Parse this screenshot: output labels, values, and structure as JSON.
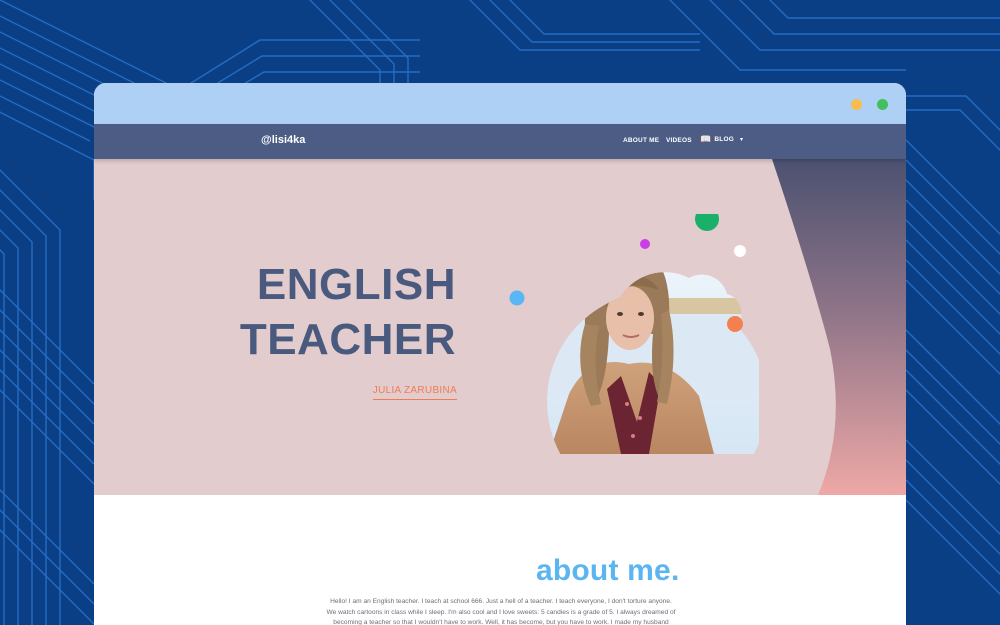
{
  "window": {
    "controls": [
      "yellow-dot",
      "green-dot"
    ]
  },
  "navbar": {
    "brand": "@lisi4ka",
    "items": [
      {
        "label": "ABOUT ME"
      },
      {
        "label": "VIDEOS"
      },
      {
        "label": "BLOG",
        "icon": "book-icon",
        "dropdown": true
      }
    ],
    "dropdown_arrow": "▾"
  },
  "hero": {
    "title_line_1": "ENGLISH",
    "title_line_2": "TEACHER",
    "subtitle": "JULIA ZARUBINA",
    "photo": "portrait of woman with long hair in beige coat, water and sky in background"
  },
  "about": {
    "title": "about me.",
    "text": "Hello! I am an English teacher. I teach at school 666. Just a hell of a teacher. I teach everyone, I don't torture anyone. We watch cartoons in class while I sleep. I'm also cool and I love sweets: 5 candies is a grade of 5. I always dreamed of becoming a teacher so that I wouldn't have to work. Well, it has become, but you have to work. I made my husband"
  },
  "colors": {
    "page_background": "#0a3f86",
    "titlebar": "#afd0f5",
    "navbar": "#4c5c85",
    "hero_background": "#e3cccd",
    "title_text": "#4a5a7e",
    "accent_orange": "#ee7c55",
    "about_title": "#5bb5f2",
    "dot_yellow": "#f7bd4e",
    "dot_green": "#41c15c"
  }
}
